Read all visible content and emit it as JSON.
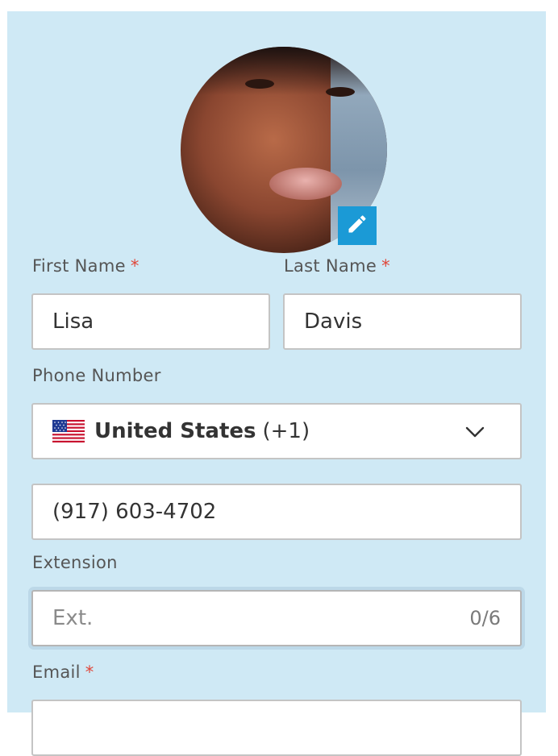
{
  "profile": {
    "edit_photo_icon": "pencil-icon"
  },
  "form": {
    "first_name": {
      "label": "First Name",
      "required_mark": "*",
      "value": "Lisa"
    },
    "last_name": {
      "label": "Last Name",
      "required_mark": "*",
      "value": "Davis"
    },
    "phone": {
      "label": "Phone Number",
      "country_flag": "us-flag-icon",
      "country_name": "United States",
      "country_code": "(+1)",
      "number": "(917) 603-4702"
    },
    "extension": {
      "label": "Extension",
      "placeholder": "Ext.",
      "counter": "0/6"
    },
    "email": {
      "label": "Email",
      "required_mark": "*"
    }
  },
  "colors": {
    "panel_bg": "#cfe9f5",
    "accent": "#1b9ad6",
    "required": "#e0473a"
  }
}
